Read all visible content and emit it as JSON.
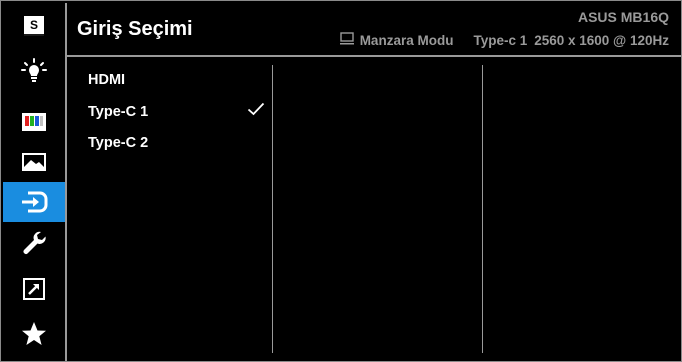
{
  "header": {
    "title": "Giriş Seçimi",
    "model": "ASUS MB16Q",
    "mode": "Manzara Modu",
    "input": "Type-c 1",
    "resolution": "2560 x 1600 @ 120Hz",
    "mode_icon": "landscape-screen-icon"
  },
  "sidebar": {
    "items": [
      {
        "icon": "splendid-icon",
        "label": "S",
        "active": false
      },
      {
        "icon": "blue-light-filter-icon",
        "active": false
      },
      {
        "icon": "color-icon",
        "active": false
      },
      {
        "icon": "image-icon",
        "active": false
      },
      {
        "icon": "input-select-icon",
        "active": true
      },
      {
        "icon": "system-setup-icon",
        "active": false
      },
      {
        "icon": "shortcut-icon",
        "active": false
      },
      {
        "icon": "myfavorite-icon",
        "active": false
      }
    ]
  },
  "options": [
    {
      "label": "HDMI",
      "selected": false
    },
    {
      "label": "Type-C 1",
      "selected": true
    },
    {
      "label": "Type-C 2",
      "selected": false
    }
  ],
  "colors": {
    "background": "#000000",
    "accent": "#1a8de0",
    "text": "#ffffff",
    "muted": "#9a9a9a"
  }
}
